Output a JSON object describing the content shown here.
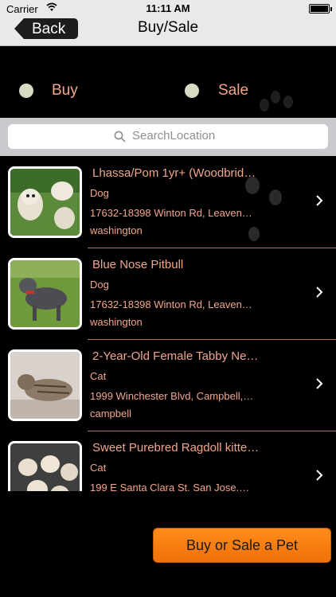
{
  "status_bar": {
    "carrier": "Carrier",
    "time": "11:11 AM"
  },
  "nav": {
    "back_label": "Back",
    "title": "Buy/Sale"
  },
  "filter": {
    "buy_label": "Buy",
    "sale_label": "Sale"
  },
  "search": {
    "placeholder": "SearchLocation"
  },
  "listings": [
    {
      "title": "Lhassa/Pom 1yr+ (Woodbrid…",
      "type": "Dog",
      "address": "17632-18398 Winton Rd, Leaven…",
      "city": "washington"
    },
    {
      "title": "Blue Nose Pitbull",
      "type": "Dog",
      "address": "17632-18398 Winton Rd, Leaven…",
      "city": "washington"
    },
    {
      "title": "2-Year-Old Female Tabby Ne…",
      "type": "Cat",
      "address": "1999 Winchester Blvd, Campbell,…",
      "city": "campbell"
    },
    {
      "title": "Sweet Purebred Ragdoll kitte…",
      "type": "Cat",
      "address": "199 E Santa Clara St, San Jose,…",
      "city": ""
    }
  ],
  "cta": {
    "label": "Buy or Sale a Pet"
  },
  "colors": {
    "accent_text": "#f3a58a",
    "cta_orange": "#f0700a",
    "background": "#000000"
  }
}
